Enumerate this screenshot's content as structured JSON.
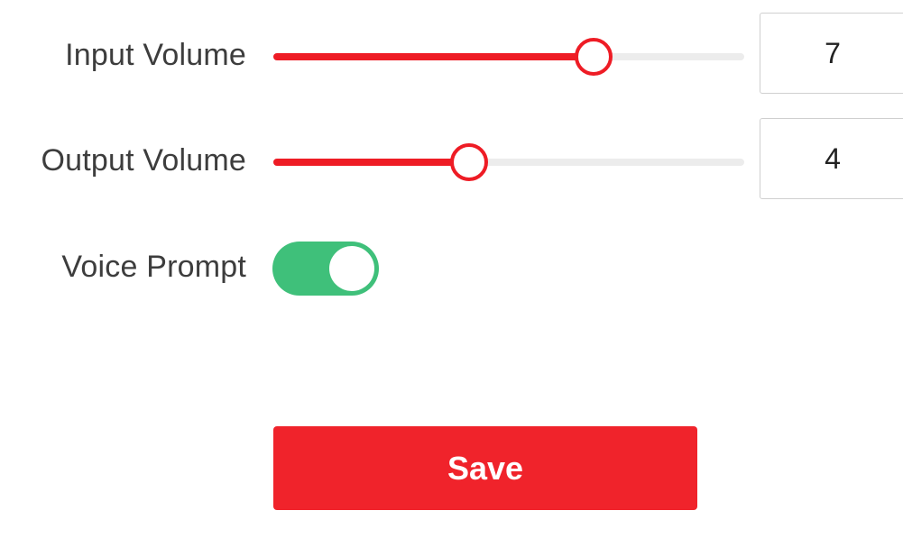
{
  "input_volume": {
    "label": "Input Volume",
    "value": "7",
    "level_fraction": 0.68
  },
  "output_volume": {
    "label": "Output Volume",
    "value": "4",
    "level_fraction": 0.415
  },
  "voice_prompt": {
    "label": "Voice Prompt",
    "enabled": true
  },
  "save_label": "Save",
  "colors": {
    "accent": "#ee1c25",
    "toggle_on": "#3fc07a",
    "track": "#ececec"
  }
}
